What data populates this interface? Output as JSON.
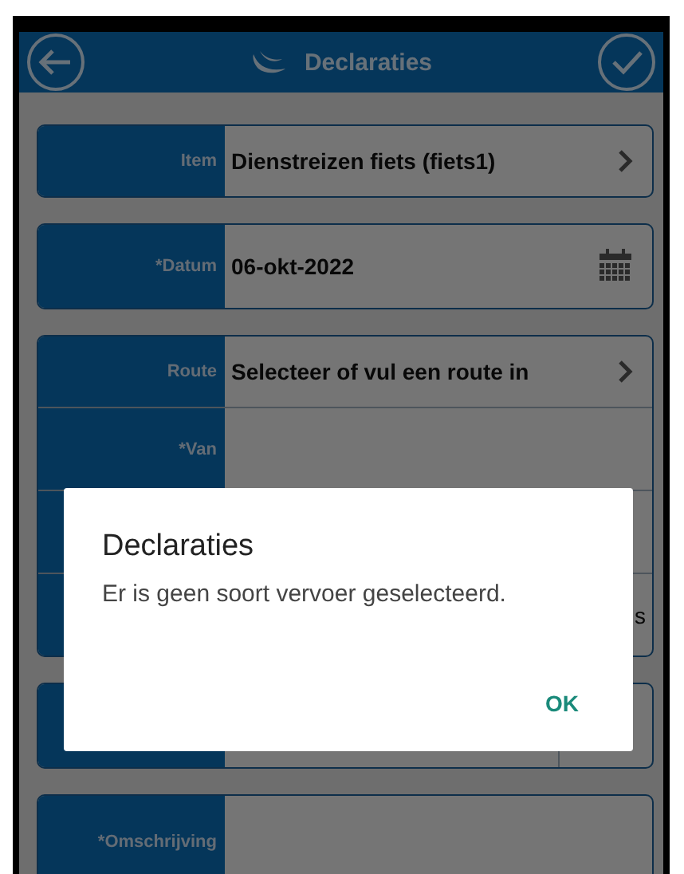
{
  "header": {
    "title": "Declaraties"
  },
  "cards": [
    {
      "rows": [
        {
          "kind": "select",
          "label": "Item",
          "value": "Dienstreizen fiets (fiets1)"
        }
      ]
    },
    {
      "rows": [
        {
          "kind": "date",
          "label": "*Datum",
          "value": "06-okt-2022"
        }
      ]
    },
    {
      "rows": [
        {
          "kind": "select",
          "label": "Route",
          "value": "Selecteer of vul een route in"
        },
        {
          "kind": "text",
          "label": "*Van"
        },
        {
          "kind": "text"
        },
        {
          "kind": "text",
          "trailing": "s"
        }
      ]
    },
    {
      "rows": [
        {
          "kind": "split"
        }
      ]
    },
    {
      "rows": [
        {
          "kind": "memo",
          "label": "*Omschrijving"
        }
      ]
    }
  ],
  "dialog": {
    "title": "Declaraties",
    "message": "Er is geen soort vervoer geselecteerd.",
    "buttons": [
      "OK"
    ]
  }
}
